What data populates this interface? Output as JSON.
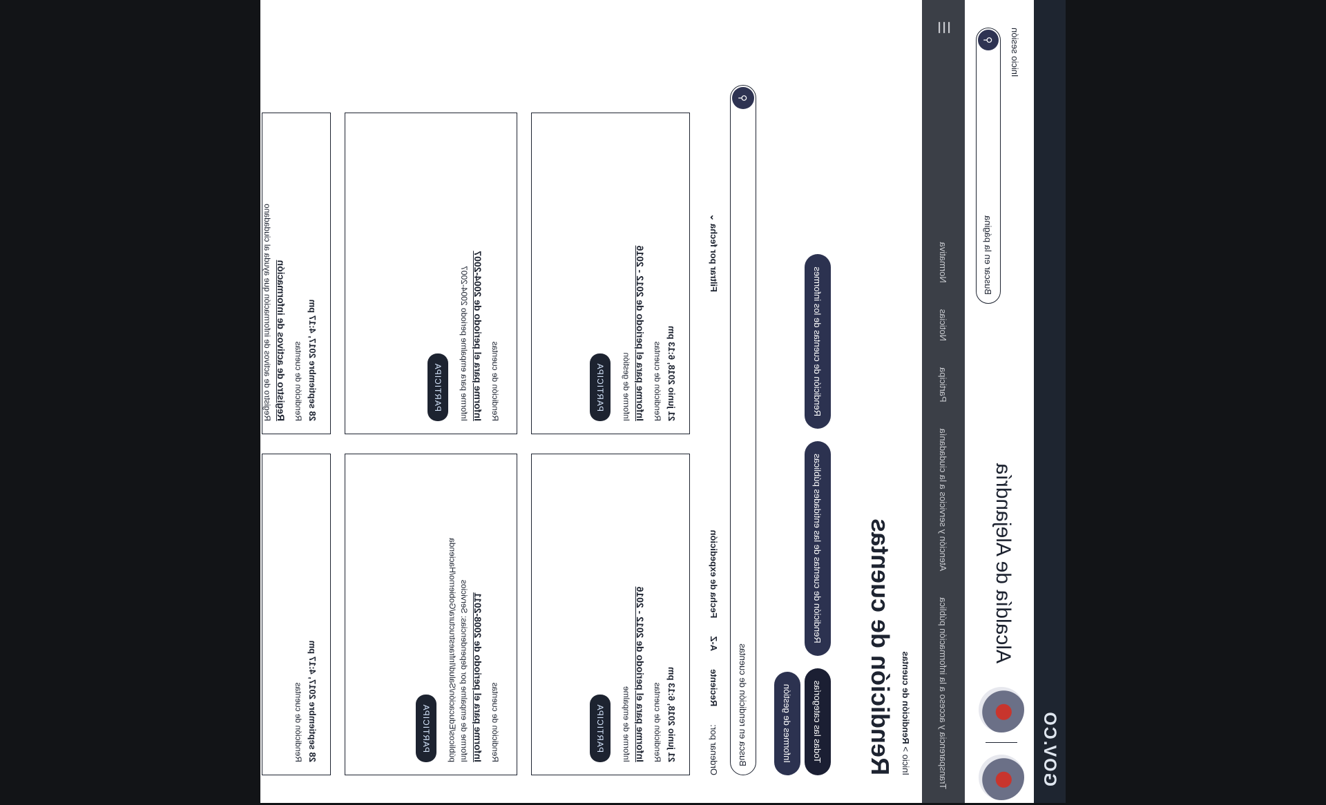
{
  "topbar": {
    "logo": "GOV.CO"
  },
  "header": {
    "title": "Alcaldía de Alejandría",
    "links": "Inicio sesión",
    "search_placeholder": "Buscar en la página"
  },
  "nav": {
    "items": [
      "Transparencia y acceso a la información pública",
      "Atención y servicios a la ciudadanía",
      "Participa",
      "Noticias",
      "Normativa",
      "Transparencia"
    ],
    "menu_icon": "hamburger-icon"
  },
  "breadcrumb": {
    "home": "Inicio",
    "sep": ">",
    "current": "Rendición de cuentas"
  },
  "page": {
    "title": "Rendición de cuentas",
    "tabs": [
      "Todas las categorías",
      "Rendición de cuentas de las entidades públicas",
      "Rendición de cuentas de los informes",
      "Informes de gestión"
    ],
    "search_placeholder": "Busca en rendición de cuentas",
    "sort_label": "Ordenar por:",
    "sort_options": [
      "Reciente",
      "A-Z",
      "Fecha de expedición"
    ],
    "filter_label": "Filtrar por fecha"
  },
  "cards": [
    {
      "date": "21 junio 2018, 6:13 pm",
      "category": "Rendición de cuentas",
      "title": "Informe para el periodo de 2012 - 2016",
      "desc": "Informe de empalme",
      "button": "PARTICIPA"
    },
    {
      "date": "21 junio 2018, 6:13 pm",
      "category": "Rendición de cuentas",
      "title": "Informe para el periodo de 2012 - 2016",
      "desc": "Informe de gestión",
      "button": "PARTICIPA"
    },
    {
      "date": "",
      "category": "Rendición de cuentas",
      "title": "Informe para el periodo de 2008-2011",
      "desc": "Informe de empalme por dependencias: Servicios públicos/Educación/Salud/Infraestructura/Gobierno/Hacienda",
      "button": "PARTICIPA"
    },
    {
      "date": "",
      "category": "Rendición de cuentas",
      "title": "Informe para el periodo de 2004-2007",
      "desc": "Informe para empalme periodo 2004-2007",
      "button": "PARTICIPA"
    },
    {
      "date": "28 septiembre 2017, 4:17 pm",
      "category": "Rendición de cuentas",
      "title": "",
      "desc": "",
      "button": ""
    },
    {
      "date": "28 septiembre 2017, 4:17 pm",
      "category": "Rendición de cuentas",
      "title": "Registro de activos de información",
      "desc": "Registro de activos de información que ayuda al ciudadano",
      "button": ""
    }
  ]
}
